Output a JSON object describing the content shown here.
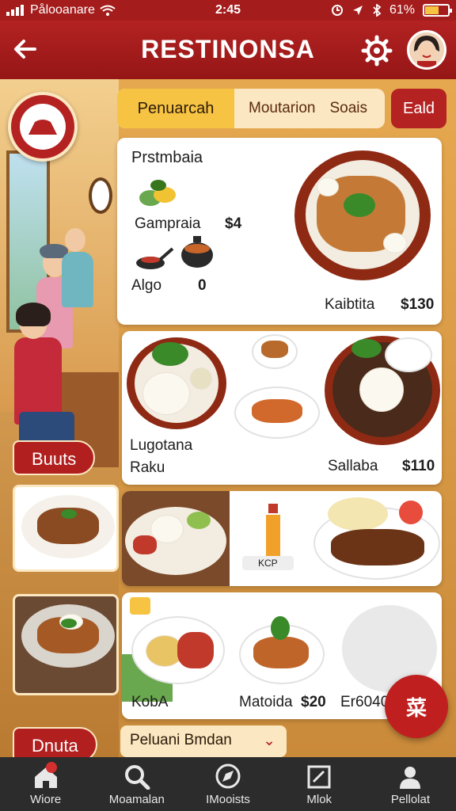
{
  "status": {
    "carrier": "Pålooanare",
    "time": "2:45",
    "battery": "61%",
    "battery_level": 0.61
  },
  "header": {
    "title": "RESTINONSA"
  },
  "tabs": [
    {
      "label": "Penuarcah"
    },
    {
      "label": "Moutarion"
    },
    {
      "label": "Soais"
    }
  ],
  "edit_label": "Eald",
  "menu": {
    "section_title": "Prstmbaia",
    "items": [
      {
        "name": "Gampraia",
        "price": "$4"
      },
      {
        "name": "Algo",
        "price": "0"
      },
      {
        "name": "Kaibtita",
        "price": "$130"
      },
      {
        "name": "Lugotana",
        "sub": "Raku",
        "price": ""
      },
      {
        "name": "Sallaba",
        "price": "$110"
      },
      {
        "name": "KobA",
        "price": ""
      },
      {
        "name": "Matoida",
        "price": "$20"
      },
      {
        "name": "Er6040",
        "price": ""
      }
    ],
    "bottle_label": "KCP"
  },
  "side_labels": {
    "first": "Buuts",
    "second": "Dnuta"
  },
  "fab_label": "菜",
  "bottom_card": {
    "label": "Peluani Bmdan",
    "chevron": "⌄"
  },
  "nav": [
    {
      "label": "Wiore"
    },
    {
      "label": "Moamalan"
    },
    {
      "label": "IMooists"
    },
    {
      "label": "Mlok"
    },
    {
      "label": "Pellolat"
    }
  ],
  "colors": {
    "primary": "#b42222",
    "accent": "#f6c343",
    "price": "#b51c1c"
  }
}
